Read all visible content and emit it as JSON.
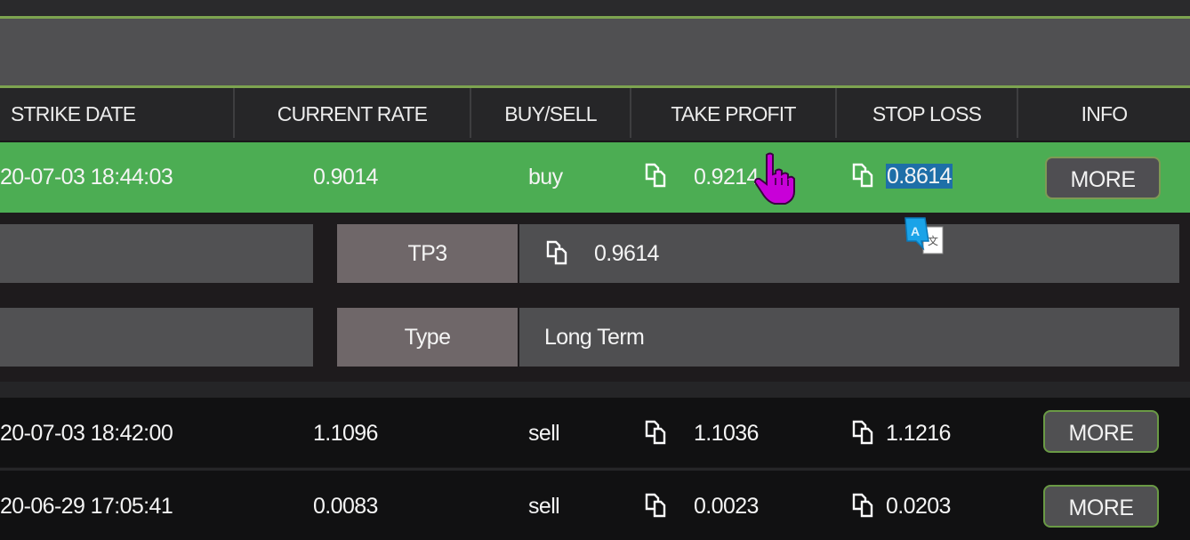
{
  "table": {
    "columns": [
      {
        "key": "strike_date",
        "label": "STRIKE DATE"
      },
      {
        "key": "current_rate",
        "label": "CURRENT RATE"
      },
      {
        "key": "buy_sell",
        "label": "BUY/SELL"
      },
      {
        "key": "take_profit",
        "label": "TAKE PROFIT"
      },
      {
        "key": "stop_loss",
        "label": "STOP LOSS"
      },
      {
        "key": "info",
        "label": "INFO"
      }
    ],
    "rows": [
      {
        "strike_date": "20-07-03 18:44:03",
        "current_rate": "0.9014",
        "buy_sell": "buy",
        "take_profit": "0.9214",
        "stop_loss": "0.8614",
        "info_button": "MORE",
        "selected": true,
        "stop_loss_text_selected": true
      },
      {
        "strike_date": "20-07-03 18:42:00",
        "current_rate": "1.1096",
        "buy_sell": "sell",
        "take_profit": "1.1036",
        "stop_loss": "1.1216",
        "info_button": "MORE"
      },
      {
        "strike_date": "20-06-29 17:05:41",
        "current_rate": "0.0083",
        "buy_sell": "sell",
        "take_profit": "0.0023",
        "stop_loss": "0.0203",
        "info_button": "MORE"
      }
    ]
  },
  "details": [
    {
      "label": "TP3",
      "value": "0.9614",
      "has_copy_icon": true
    },
    {
      "label": "Type",
      "value": "Long Term",
      "has_copy_icon": false
    }
  ],
  "overlay": {
    "cursor": "hand-pointer-icon",
    "translate_popup": "translate-icon",
    "translate_glyph": "A"
  },
  "colors": {
    "accent_green": "#4cad53",
    "border_green": "#7da450",
    "selection_blue": "#1e6fa8",
    "cursor_magenta": "#c800d8"
  }
}
